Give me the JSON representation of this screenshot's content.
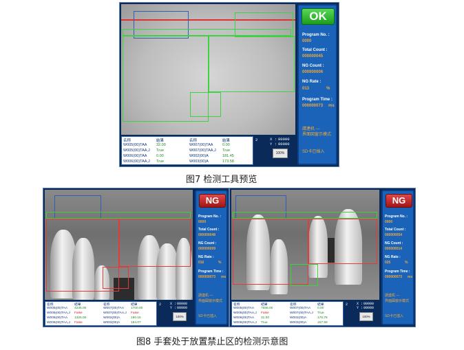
{
  "fig7": {
    "status_button": "OK",
    "program_no_label": "Program No. :",
    "program_no": "0000",
    "total_count_label": "Total Count :",
    "total_count": "000000045",
    "ng_count_label": "NG Count :",
    "ng_count": "000000006",
    "ng_rate_label": "NG Rate :",
    "ng_rate": "013",
    "ng_rate_unit": "%",
    "program_time_label": "Program Time :",
    "program_time": "000000073",
    "program_time_unit": "ms",
    "status_line1": "請連机 —",
    "status_line2": "界面図窗示模式",
    "sd_status": "SD卡已插入",
    "table": {
      "headers": [
        "名称",
        "結果",
        "名称",
        "結果"
      ],
      "rows": [
        [
          "W005(00)TAA",
          "32.00",
          "W007(00)TAA",
          "0.00"
        ],
        [
          "W005(00)TAA,J",
          "True",
          "W007(00)TAA,J",
          "True"
        ],
        [
          "W006(00)TAA",
          "0.00",
          "W002(00)A",
          "181.45"
        ],
        [
          "W006(00)TAA,J",
          "True",
          "W003(00)A",
          "173.58"
        ]
      ],
      "page": "2",
      "x_label": "X :",
      "x_value": "00000",
      "y_label": "Y :",
      "y_value": "00000",
      "zoom": "100%"
    },
    "caption": "图7  检测工具预览"
  },
  "fig8a": {
    "status_button": "NG",
    "program_no_label": "Program No. :",
    "program_no": "0000",
    "total_count_label": "Total Count :",
    "total_count": "000000048",
    "ng_count_label": "NG Count :",
    "ng_count": "000000009",
    "ng_rate_label": "NG Rate :",
    "ng_rate": "016",
    "ng_rate_unit": "%",
    "program_time_label": "Program Time :",
    "program_time": "000000073",
    "program_time_unit": "ms",
    "status_line1": "請連机 —",
    "status_line2": "界面図窗示模式",
    "sd_status": "SD卡已插入",
    "table": {
      "headers": [
        "名称",
        "結果",
        "名称",
        "結果"
      ],
      "rows": [
        [
          "W005(00)TAA",
          "4235.00",
          "W007(00)TAA",
          "1700.00"
        ],
        [
          "W005(00)TAA,J",
          "False",
          "W007(00)TAA,J",
          "False"
        ],
        [
          "W006(00)TAA",
          "1325.00",
          "W002(00)A",
          "190.15"
        ],
        [
          "W006(00)TAA,J",
          "False",
          "W003(00)A",
          "184.07"
        ]
      ],
      "page": "2",
      "x_label": "X :",
      "x_value": "00000",
      "y_label": "Y :",
      "y_value": "00000",
      "zoom": "100%"
    }
  },
  "fig8b": {
    "status_button": "NG",
    "program_no_label": "Program No. :",
    "program_no": "0000",
    "total_count_label": "Total Count :",
    "total_count": "000000054",
    "ng_count_label": "NG Count :",
    "ng_count": "000000014",
    "ng_rate_label": "NG Rate :",
    "ng_rate": "025",
    "ng_rate_unit": "%",
    "program_time_label": "Program Time :",
    "program_time": "000000073",
    "program_time_unit": "ms",
    "status_line1": "請連机 —",
    "status_line2": "界面図窗示模式",
    "sd_status": "SD卡已插入",
    "table": {
      "headers": [
        "名称",
        "結果",
        "名称",
        "結果"
      ],
      "rows": [
        [
          "W005(00)TAA",
          "7656.00",
          "W007(00)TAA",
          "0.00"
        ],
        [
          "W005(00)TAA,J",
          "False",
          "W007(00)TAA,J",
          "True"
        ],
        [
          "W006(00)TAA",
          "31.00",
          "W002(00)A",
          "176.78"
        ],
        [
          "W006(00)TAA,J",
          "True",
          "W003(00)A",
          "157.59"
        ]
      ],
      "page": "2",
      "x_label": "X :",
      "x_value": "00000",
      "y_label": "Y :",
      "y_value": "00000",
      "zoom": "100%"
    },
    "caption": "图8  手套处于放置禁止区的检测示意图"
  },
  "colors": {
    "panel_bg": "#0a2a5a",
    "side_bg": "#1a63b8",
    "ok_green": "#2fbf2f",
    "ng_red": "#c62828",
    "value_orange": "#f2a93a",
    "roi_green": "#3fd23f",
    "roi_red": "#e33b3b",
    "roi_blue": "#2f5fb0"
  }
}
